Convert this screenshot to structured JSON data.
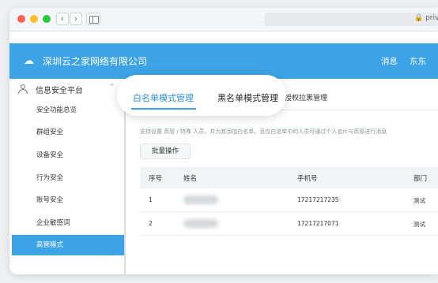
{
  "browser": {
    "url": "🔒 priva"
  },
  "header": {
    "brand": "深圳云之家网络有限公司",
    "links": [
      "消息",
      "东东"
    ]
  },
  "sidebar": {
    "title": "信息安全平台",
    "items": [
      {
        "label": "安全功能总览",
        "active": false
      },
      {
        "label": "群组安全",
        "active": false
      },
      {
        "label": "设备安全",
        "active": false
      },
      {
        "label": "行为安全",
        "active": false
      },
      {
        "label": "账号安全",
        "active": false
      },
      {
        "label": "企业敏感词",
        "active": false
      },
      {
        "label": "高管模式",
        "active": true
      }
    ]
  },
  "tabs": {
    "items": [
      {
        "label": "白名单模式管理",
        "active": true
      },
      {
        "label": "黑名单模式管理",
        "active": false
      },
      {
        "label": "授权拉黑管理",
        "active": false
      }
    ]
  },
  "main": {
    "description": "支持设置 高管 / 特殊 人员，并为其添加白名单，且仅白名单中的人员可通过个人名片与高管进行消息",
    "batch_button": "批量操作",
    "table": {
      "columns": [
        "序号",
        "姓名",
        "手机号",
        "部门"
      ],
      "rows": [
        {
          "index": "1",
          "phone": "17217217235",
          "dept": "测试"
        },
        {
          "index": "2",
          "phone": "17217217071",
          "dept": "测试"
        }
      ]
    }
  },
  "colors": {
    "accent": "#3ca3e6",
    "active_tab_text": "#2e8fd8"
  }
}
